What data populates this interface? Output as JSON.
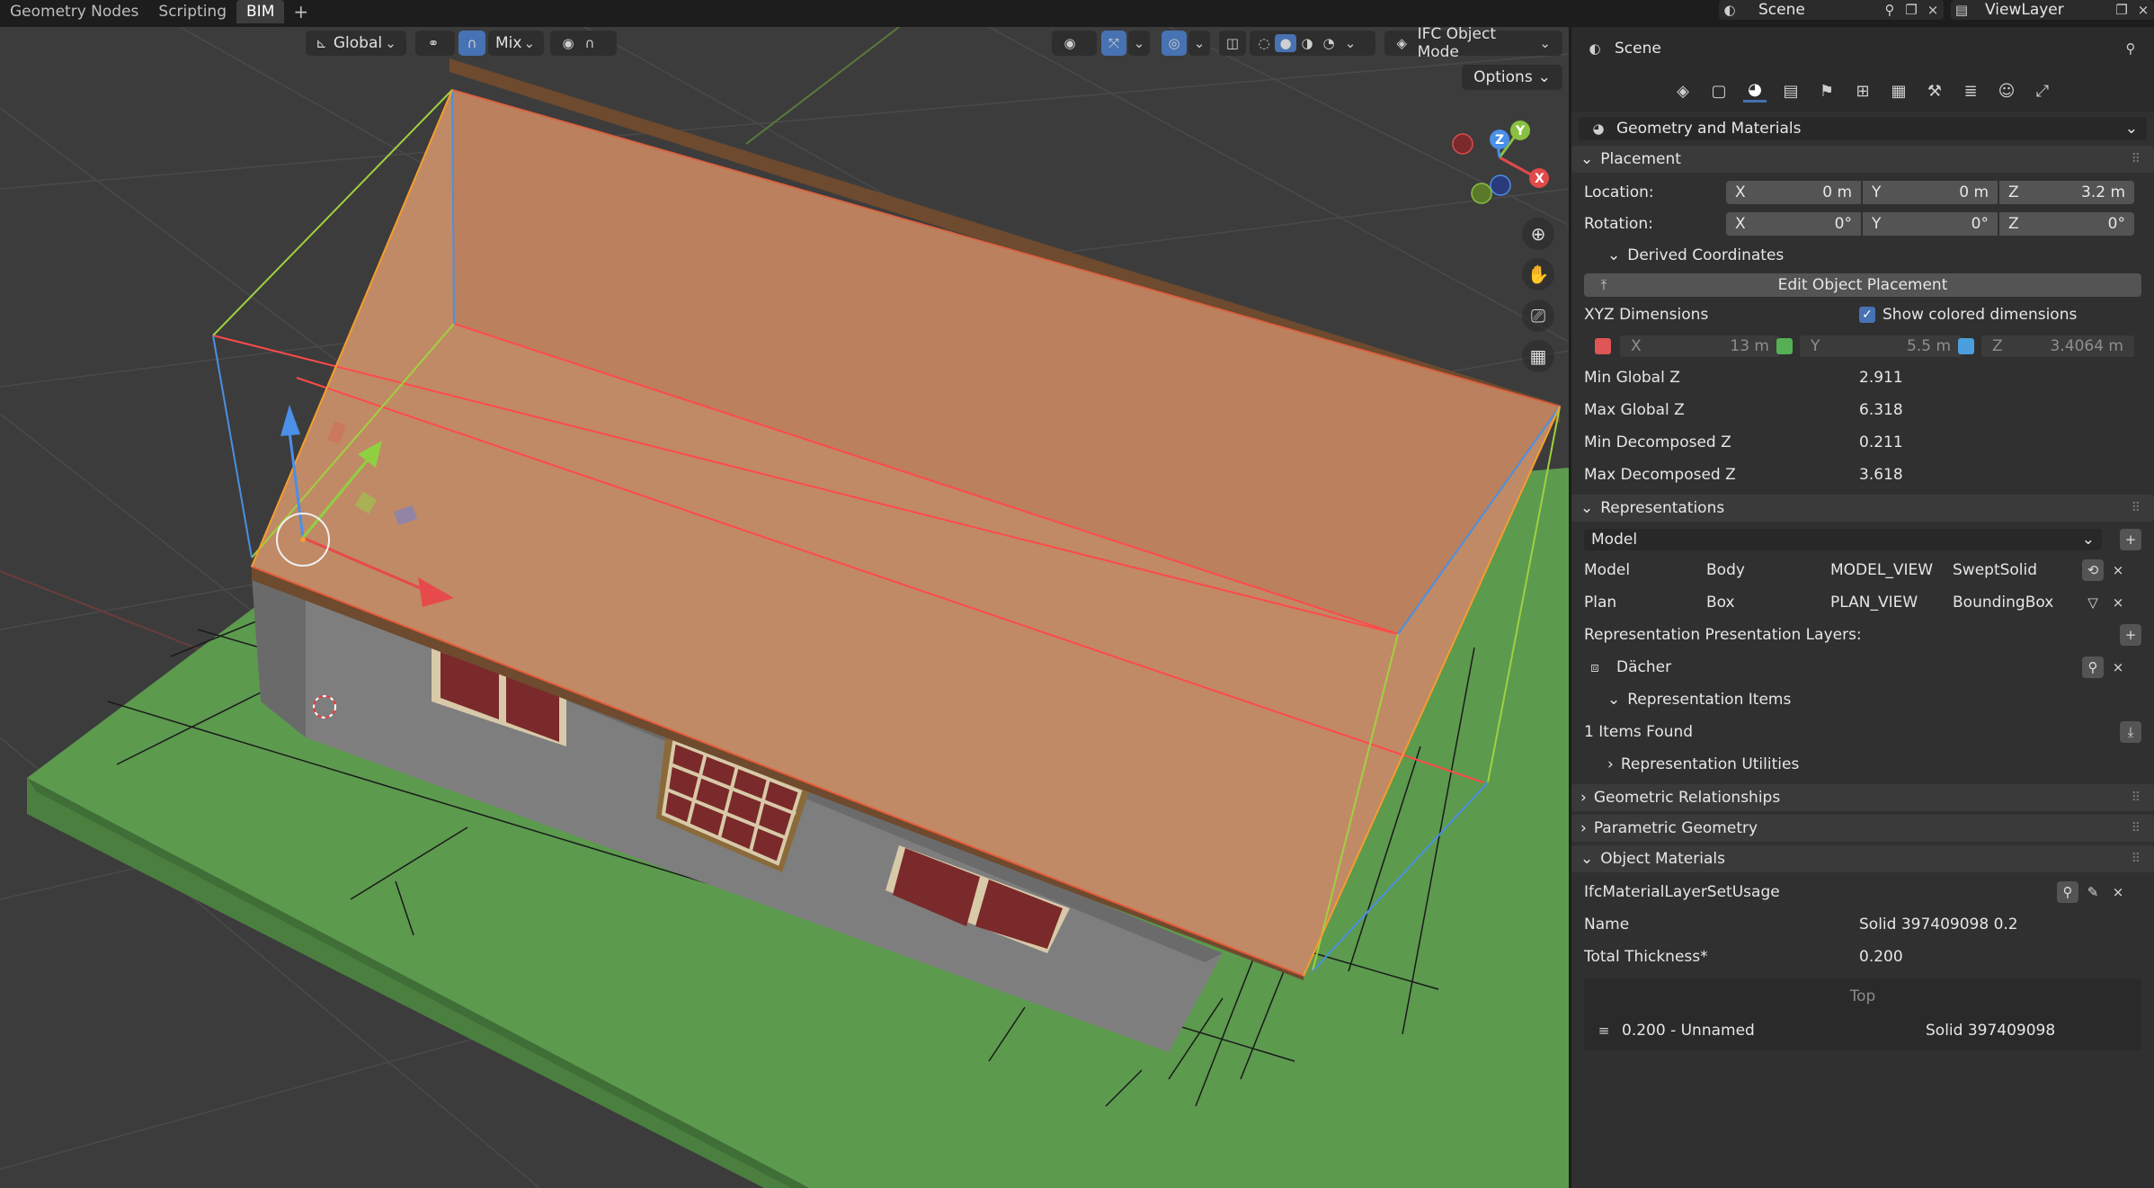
{
  "topbar": {
    "tabs": [
      {
        "label": "Geometry Nodes"
      },
      {
        "label": "Scripting"
      },
      {
        "label": "BIM"
      }
    ],
    "add_tab": "+",
    "scene": "Scene",
    "view_layer": "ViewLayer"
  },
  "viewport": {
    "transform_orientation": "Global",
    "snap_mode": "Mix",
    "mode": "IFC Object Mode",
    "options": "Options",
    "gizmo_axes": [
      "X",
      "Y",
      "Z"
    ]
  },
  "properties": {
    "header": "Scene",
    "tab_icons": [
      "ifc-tab-icon",
      "object-tab-icon",
      "geometry-tab-icon",
      "material-tab-icon",
      "scene-tab-icon",
      "structure-tab-icon",
      "grid-tab-icon",
      "tool-tab-icon",
      "stack-tab-icon",
      "people-tab-icon",
      "services-tab-icon"
    ],
    "section_dropdown": "Geometry and Materials",
    "placement": {
      "title": "Placement",
      "location_label": "Location:",
      "location": [
        {
          "axis": "X",
          "value": "0 m"
        },
        {
          "axis": "Y",
          "value": "0 m"
        },
        {
          "axis": "Z",
          "value": "3.2 m"
        }
      ],
      "rotation_label": "Rotation:",
      "rotation": [
        {
          "axis": "X",
          "value": "0°"
        },
        {
          "axis": "Y",
          "value": "0°"
        },
        {
          "axis": "Z",
          "value": "0°"
        }
      ],
      "derived_title": "Derived Coordinates",
      "edit_button": "Edit Object Placement",
      "xyz_label": "XYZ Dimensions",
      "show_colored": "Show colored dimensions",
      "dims": [
        {
          "axis": "X",
          "value": "13 m",
          "color": "#e05555"
        },
        {
          "axis": "Y",
          "value": "5.5 m",
          "color": "#55b055"
        },
        {
          "axis": "Z",
          "value": "3.4064 m",
          "color": "#4a9fdc"
        }
      ],
      "stats": [
        {
          "label": "Min Global Z",
          "value": "2.911"
        },
        {
          "label": "Max Global Z",
          "value": "6.318"
        },
        {
          "label": "Min Decomposed Z",
          "value": "0.211"
        },
        {
          "label": "Max Decomposed Z",
          "value": "3.618"
        }
      ]
    },
    "representations": {
      "title": "Representations",
      "context": "Model",
      "rows": [
        {
          "context": "Model",
          "identifier": "Body",
          "target_view": "MODEL_VIEW",
          "type": "SweptSolid"
        },
        {
          "context": "Plan",
          "identifier": "Box",
          "target_view": "PLAN_VIEW",
          "type": "BoundingBox"
        }
      ],
      "layers_label": "Representation Presentation Layers:",
      "layer": "Dächer",
      "items_title": "Representation Items",
      "items_found": "1 Items Found",
      "utilities": "Representation Utilities"
    },
    "collapsed_panels": [
      "Geometric Relationships",
      "Parametric Geometry"
    ],
    "materials": {
      "title": "Object Materials",
      "usage": "IfcMaterialLayerSetUsage",
      "name_label": "Name",
      "name_value": "Solid 397409098 0.2",
      "thickness_label": "Total Thickness*",
      "thickness_value": "0.200",
      "top_label": "Top",
      "layer_name": "0.200 - Unnamed",
      "layer_material": "Solid 397409098"
    }
  }
}
